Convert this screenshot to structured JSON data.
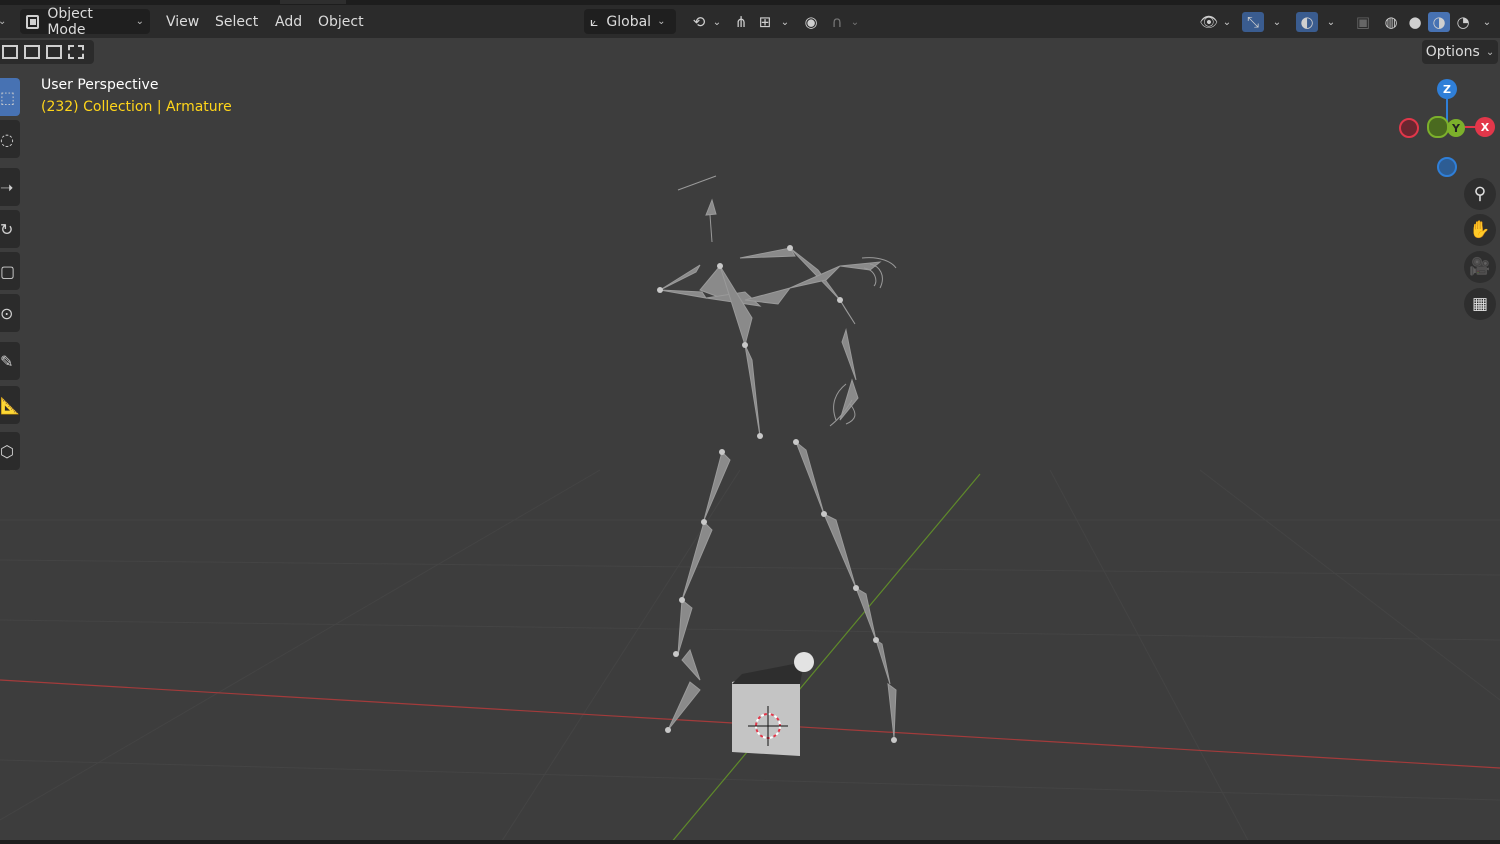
{
  "header": {
    "mode": "Object Mode",
    "menus": [
      "View",
      "Select",
      "Add",
      "Object"
    ],
    "orientation": "Global"
  },
  "overlay": {
    "view_name": "User Perspective",
    "frame": "(232)",
    "collection": "Collection",
    "separator": "|",
    "object": "Armature",
    "options_label": "Options"
  },
  "gizmo": {
    "z": "Z",
    "y": "Y",
    "x": "X"
  },
  "colors": {
    "accent": "#4772b3",
    "x_axis": "#e2374a",
    "y_axis": "#7cb02b",
    "z_axis": "#2f7fd8",
    "text_active": "#ffd51a"
  },
  "icons": [
    "select-box-icon",
    "cursor-icon",
    "move-icon",
    "rotate-icon",
    "scale-icon",
    "transform-icon",
    "annotate-icon",
    "measure-icon",
    "add-cube-icon",
    "zoom-icon",
    "hand-pan-icon",
    "camera-icon",
    "grid-view-icon"
  ]
}
